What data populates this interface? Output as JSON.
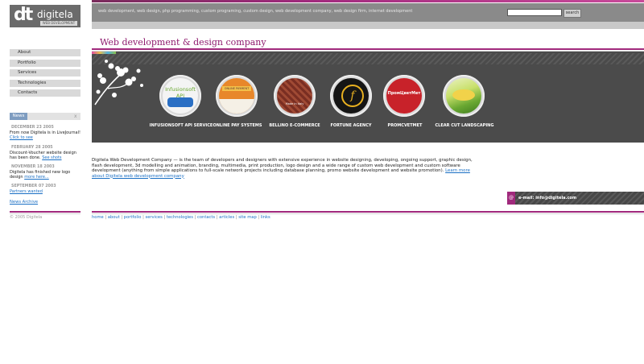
{
  "logo": {
    "mark": "dt",
    "name": "digitela",
    "tagline": "WEB DEVELOPMENT"
  },
  "header": {
    "keywords": "web development, web design, php programming, custom programing, custom design, web development company, web design firm, internet development",
    "search_button": "search",
    "search_placeholder": ""
  },
  "page_title": "Web development & design company",
  "nav": [
    {
      "label": "About"
    },
    {
      "label": "Portfolio"
    },
    {
      "label": "Services"
    },
    {
      "label": "Technologies"
    },
    {
      "label": "Contacts"
    }
  ],
  "news": {
    "tab": "News",
    "close": "x",
    "items": [
      {
        "date": "DECEMBER 23 2005",
        "text": "From now Digitela is in LiveJournal!",
        "link": "Click to see"
      },
      {
        "date": "FEBRUARY 28 2005",
        "text": "Discount-Voucher website design has been done.",
        "link": "See shots"
      },
      {
        "date": "NOVEMBER 18 2003",
        "text": "Digitela has finished new logo design",
        "link": "more here..."
      },
      {
        "date": "SEPTEMBER 07 2003",
        "text": "",
        "link": "Partners wanted"
      }
    ],
    "archive": "News Archive"
  },
  "copyright": "© 2005 Digitela",
  "portfolio": [
    {
      "label": "INFUSIONSOFT API SERVICE",
      "art_text": "Infusionsoft API",
      "color": "#f2f2f2"
    },
    {
      "label": "ONLINE PAY SYSTEMS",
      "art_text": "ONLINE PAYMENT",
      "color": "#e8872a"
    },
    {
      "label": "BELLINO E-COMMERCE",
      "art_text": "Made in Italy",
      "color": "#8a3a2a"
    },
    {
      "label": "FORTUNE AGENCY",
      "art_text": "f",
      "color": "#1a1a1a"
    },
    {
      "label": "PROMCVETMET",
      "art_text": "ПромЦветМет",
      "color": "#c8222a"
    },
    {
      "label": "CLEAR CUT LANDSCAPING",
      "art_text": "",
      "color": "#6aa832"
    }
  ],
  "description": {
    "text": "Digitela Web Development Company — is the team of developers and designers with extensive experience in website designing, developing, ongoing support, graphic design, flash development, 3d modelling and animation, branding, multimedia, print production, logo design and a wide range of custom web development and custom software development (anything from simple applications to full-scale network projects including database planning, promo website development and website promotion).",
    "link": "Learn more about Digitela web development company"
  },
  "email": {
    "icon": "@",
    "text": "e-mail: info@digitela.com"
  },
  "footer": [
    "home",
    "about",
    "portfolio",
    "services",
    "technologies",
    "contacts",
    "articles",
    "site map",
    "links"
  ],
  "colors": {
    "accent": "#a0297c",
    "banner": "#4b4b4b",
    "link": "#1a6fc4"
  }
}
